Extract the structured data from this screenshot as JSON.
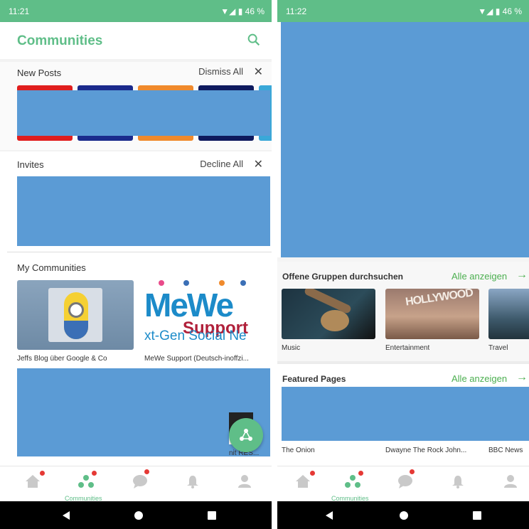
{
  "left": {
    "status": {
      "time": "11:21",
      "battery": "46 %"
    },
    "app_title": "Communities",
    "new_posts": {
      "title": "New Posts",
      "action": "Dismiss All",
      "close": "✕"
    },
    "invites": {
      "title": "Invites",
      "action": "Decline All",
      "close": "✕"
    },
    "my_communities": {
      "title": "My Communities",
      "items": [
        {
          "caption": "Jeffs Blog über Google & Co"
        },
        {
          "caption": "MeWe Support (Deutsch-inoffzi...",
          "logo_text": "MeWe",
          "logo_sub": "Support",
          "logo_tag": "xt-Gen Social Ne"
        }
      ],
      "partial_caption": "nit RES..."
    },
    "nav": {
      "communities_label": "Communities"
    }
  },
  "right": {
    "status": {
      "time": "11:22",
      "battery": "46 %"
    },
    "groups": {
      "title": "Offene Gruppen durchsuchen",
      "action": "Alle anzeigen",
      "items": [
        {
          "caption": "Music"
        },
        {
          "caption": "Entertainment",
          "sign": "HOLLYWOOD"
        },
        {
          "caption": "Travel"
        }
      ]
    },
    "featured": {
      "title": "Featured Pages",
      "action": "Alle anzeigen",
      "items": [
        {
          "caption": "The Onion"
        },
        {
          "caption": "Dwayne The Rock John..."
        },
        {
          "caption": "BBC News"
        }
      ]
    },
    "nav": {
      "communities_label": "Communities"
    }
  },
  "colors": {
    "accent": "#5fbe88",
    "redaction": "#5b9bd5",
    "badge": "#e53935",
    "link": "#4caf50"
  }
}
